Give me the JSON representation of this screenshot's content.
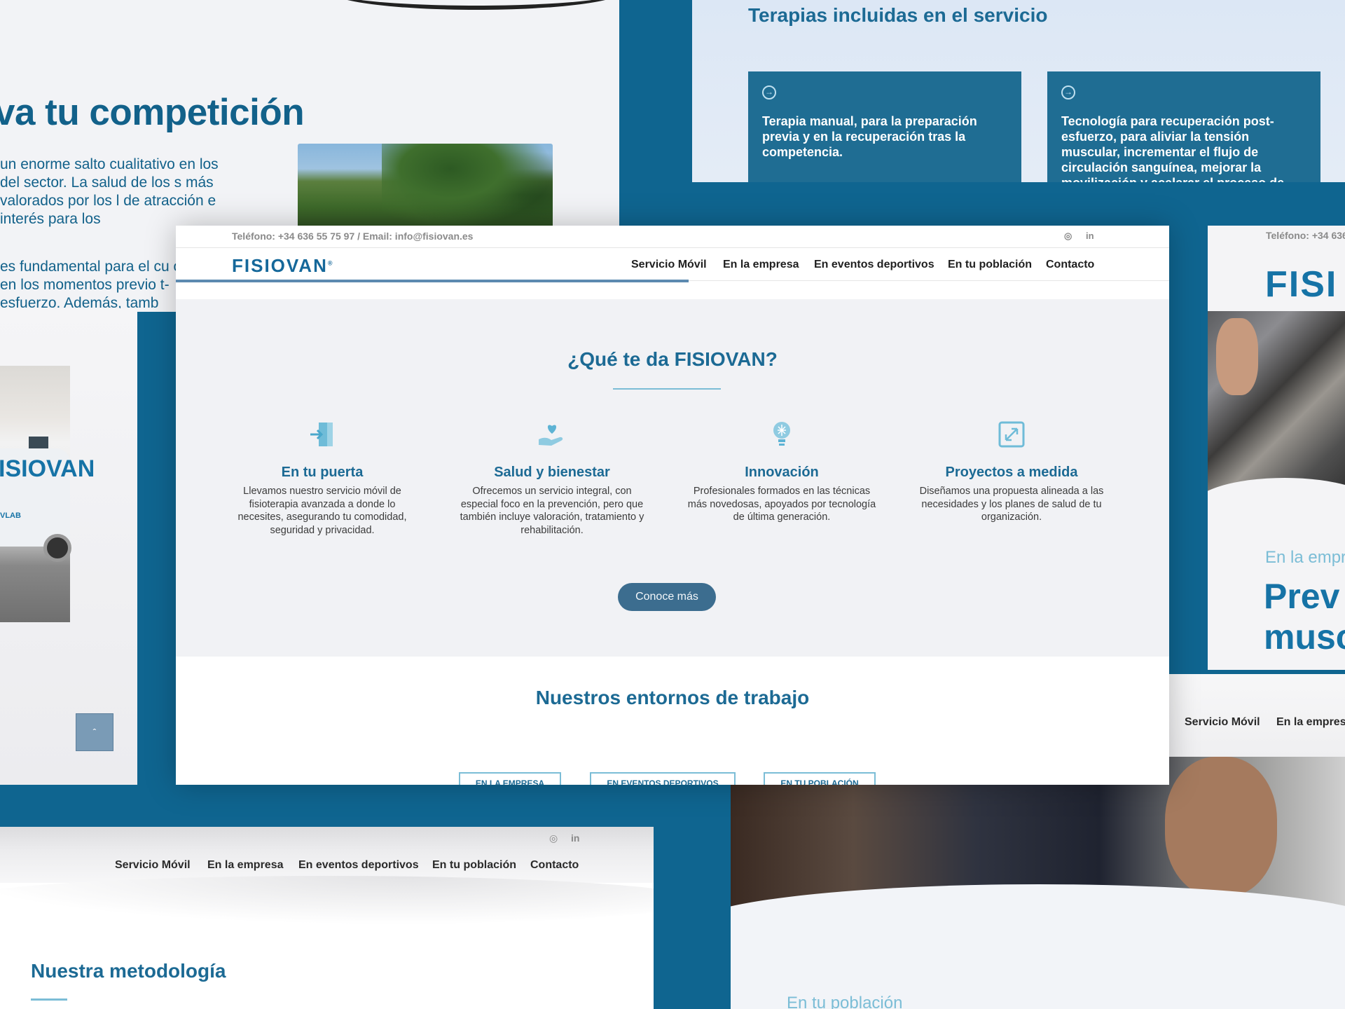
{
  "competition_panel": {
    "heading": "va tu competición",
    "paragraph": "un enorme salto cualitativo en los del sector. La salud de los s más valorados por los l de atracción e interés para los",
    "paragraph2": "es fundamental para el cu o en los momentos previo t-esfuerzo. Además, tamb"
  },
  "van_panel": {
    "van_logo": "ISIOVAN",
    "van_sub": "VLAB"
  },
  "therapies_panel": {
    "heading": "Terapias incluidas en el servicio",
    "cards": [
      {
        "icon": "arrow-circle-icon",
        "text": "Terapia manual, para la preparación previa y en la recuperación tras la competencia."
      },
      {
        "icon": "arrow-circle-icon",
        "text": "Tecnología para recuperación post-esfuerzo, para aliviar la tensión muscular, incrementar el flujo de circulación sanguínea, mejorar la movilización y acelerar el proceso de reparación del"
      }
    ]
  },
  "right_panel": {
    "phone": "Teléfono: +34 636",
    "logo": "FISI",
    "kicker": "En la empr",
    "headline_line1": "Prev",
    "headline_line2": "musc"
  },
  "bottom_left_panel": {
    "social": [
      "◎",
      "in"
    ],
    "nav": [
      "Servicio Móvil",
      "En la empresa",
      "En eventos deportivos",
      "En tu población",
      "Contacto"
    ],
    "heading": "Nuestra metodología"
  },
  "bottom_right_panel": {
    "nav": [
      "Servicio Móvil",
      "En la empresa"
    ],
    "kicker": "En tu población"
  },
  "main": {
    "contact": "Teléfono: +34 636 55 75 97 / Email: info@fisiovan.es",
    "social": [
      "◎",
      "in"
    ],
    "logo": "FISIOVAN",
    "logo_mark": "®",
    "nav": [
      "Servicio Móvil",
      "En la empresa",
      "En eventos deportivos",
      "En tu población",
      "Contacto"
    ],
    "section_title": "¿Qué te da FISIOVAN?",
    "features": [
      {
        "icon": "door-enter-icon",
        "title": "En tu puerta",
        "text": "Llevamos nuestro servicio móvil de fisioterapia avanzada a donde lo necesites, asegurando tu comodidad, seguridad y privacidad."
      },
      {
        "icon": "heart-hand-icon",
        "title": "Salud y bienestar",
        "text": "Ofrecemos un servicio integral, con especial foco en la prevención, pero que también incluye valoración, tratamiento y rehabilitación."
      },
      {
        "icon": "lightbulb-brain-icon",
        "title": "Innovación",
        "text": "Profesionales formados en las técnicas más novedosas, apoyados por tecnología de última generación."
      },
      {
        "icon": "expand-arrows-icon",
        "title": "Proyectos a medida",
        "text": "Diseñamos una propuesta alineada a las necesidades y los planes de salud de tu organización."
      }
    ],
    "cta": "Conoce más",
    "environments_title": "Nuestros entornos de trabajo",
    "env_buttons": [
      "EN LA EMPRESA",
      "EN EVENTOS DEPORTIVOS",
      "EN TU POBLACIÓN"
    ]
  },
  "scroll_top_icon": "chevron-up-icon",
  "scroll_top_glyph": "ˆ",
  "colors": {
    "brand": "#1c6a94",
    "accent": "#7bbdd6",
    "background": "#0f6590",
    "button": "#3c6d8f"
  }
}
